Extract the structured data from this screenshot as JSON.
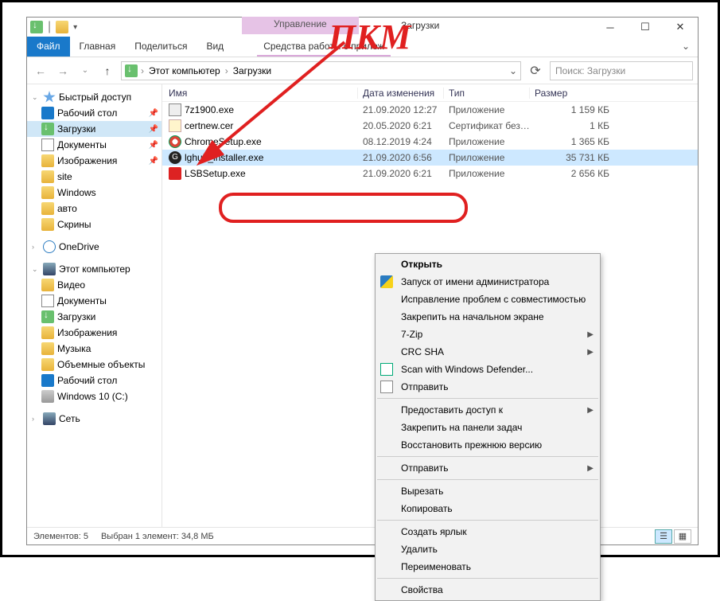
{
  "window": {
    "ctx_tab": "Управление",
    "title": "Загрузки",
    "ribbon": {
      "file": "Файл",
      "tabs": [
        "Главная",
        "Поделиться",
        "Вид"
      ],
      "ctx2": "Средства работы с прилож"
    },
    "breadcrumb": {
      "seg1": "Этот компьютер",
      "seg2": "Загрузки"
    },
    "search_placeholder": "Поиск: Загрузки",
    "columns": {
      "name": "Имя",
      "date": "Дата изменения",
      "type": "Тип",
      "size": "Размер"
    },
    "status": {
      "count": "Элементов: 5",
      "selection": "Выбран 1 элемент: 34,8 МБ"
    }
  },
  "nav": {
    "quick": {
      "label": "Быстрый доступ",
      "items": [
        {
          "label": "Рабочий стол",
          "pin": true
        },
        {
          "label": "Загрузки",
          "pin": true,
          "selected": true
        },
        {
          "label": "Документы",
          "pin": true
        },
        {
          "label": "Изображения",
          "pin": true
        },
        {
          "label": "site"
        },
        {
          "label": "Windows"
        },
        {
          "label": "авто"
        },
        {
          "label": "Скрины"
        }
      ]
    },
    "onedrive": "OneDrive",
    "thispc": {
      "label": "Этот компьютер",
      "items": [
        "Видео",
        "Документы",
        "Загрузки",
        "Изображения",
        "Музыка",
        "Объемные объекты",
        "Рабочий стол",
        "Windows 10 (C:)"
      ]
    },
    "network": "Сеть"
  },
  "files": [
    {
      "name": "7z1900.exe",
      "date": "21.09.2020 12:27",
      "type": "Приложение",
      "size": "1 159 КБ",
      "icon": "exe"
    },
    {
      "name": "certnew.cer",
      "date": "20.05.2020 6:21",
      "type": "Сертификат безо...",
      "size": "1 КБ",
      "icon": "cert"
    },
    {
      "name": "ChromeSetup.exe",
      "date": "08.12.2019 4:24",
      "type": "Приложение",
      "size": "1 365 КБ",
      "icon": "chrome"
    },
    {
      "name": "lghub_installer.exe",
      "date": "21.09.2020 6:56",
      "type": "Приложение",
      "size": "35 731 КБ",
      "icon": "g",
      "selected": true
    },
    {
      "name": "LSBSetup.exe",
      "date": "21.09.2020 6:21",
      "type": "Приложение",
      "size": "2 656 КБ",
      "icon": "red"
    }
  ],
  "context_menu": {
    "open": "Открыть",
    "run_as_admin": "Запуск от имени администратора",
    "troubleshoot": "Исправление проблем с совместимостью",
    "pin_start": "Закрепить на начальном экране",
    "sevenzip": "7-Zip",
    "crc": "CRC SHA",
    "defender": "Scan with Windows Defender...",
    "send": "Отправить",
    "access": "Предоставить доступ к",
    "pin_taskbar": "Закрепить на панели задач",
    "restore": "Восстановить прежнюю версию",
    "sendto": "Отправить",
    "cut": "Вырезать",
    "copy": "Копировать",
    "shortcut": "Создать ярлык",
    "delete": "Удалить",
    "rename": "Переименовать",
    "properties": "Свойства"
  },
  "annotation": {
    "label": "ПКМ"
  }
}
